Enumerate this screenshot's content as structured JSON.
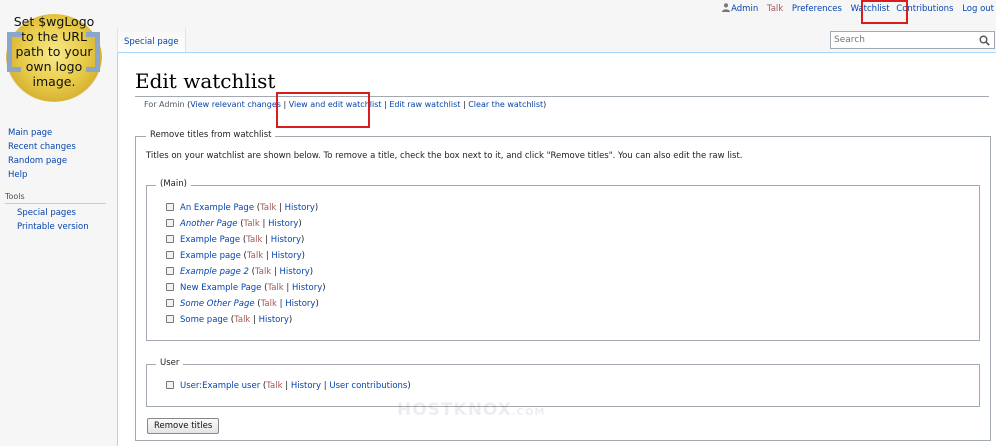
{
  "logo": {
    "line1": "Set $wgLogo",
    "line2": "to the URL",
    "line3": "path to your",
    "line4": "own logo",
    "line5": "image."
  },
  "personal": {
    "user": "Admin",
    "talk": "Talk",
    "preferences": "Preferences",
    "watchlist": "Watchlist",
    "contributions": "Contributions",
    "logout": "Log out"
  },
  "sidebar": {
    "nav": [
      "Main page",
      "Recent changes",
      "Random page",
      "Help"
    ],
    "tools_heading": "Tools",
    "tools": [
      "Special pages",
      "Printable version"
    ]
  },
  "tab": "Special page",
  "search": {
    "placeholder": "Search"
  },
  "page": {
    "title": "Edit watchlist",
    "subtitle": {
      "for": "For Admin",
      "open": " (",
      "view": "View relevant changes",
      "sep": " | ",
      "edit": "View and edit watchlist",
      "raw": "Edit raw watchlist",
      "clear": "Clear the watchlist",
      "close": ")"
    }
  },
  "form": {
    "legend": "Remove titles from watchlist",
    "intro": "Titles on your watchlist are shown below. To remove a title, check the box next to it, and click \"Remove titles\". You can also edit the raw list.",
    "main_legend": "(Main)",
    "user_legend": "User",
    "talk": "Talk",
    "history": "History",
    "contribs": "User contributions",
    "main_pages": [
      "An Example Page",
      "Another Page",
      "Example Page",
      "Example page",
      "Example page 2",
      "New Example Page",
      "Some Other Page",
      "Some page"
    ],
    "user_pages": [
      "User:Example user"
    ],
    "submit": "Remove titles"
  },
  "watermark": {
    "name": "HOSTKNOX",
    "tld": ".COM"
  }
}
